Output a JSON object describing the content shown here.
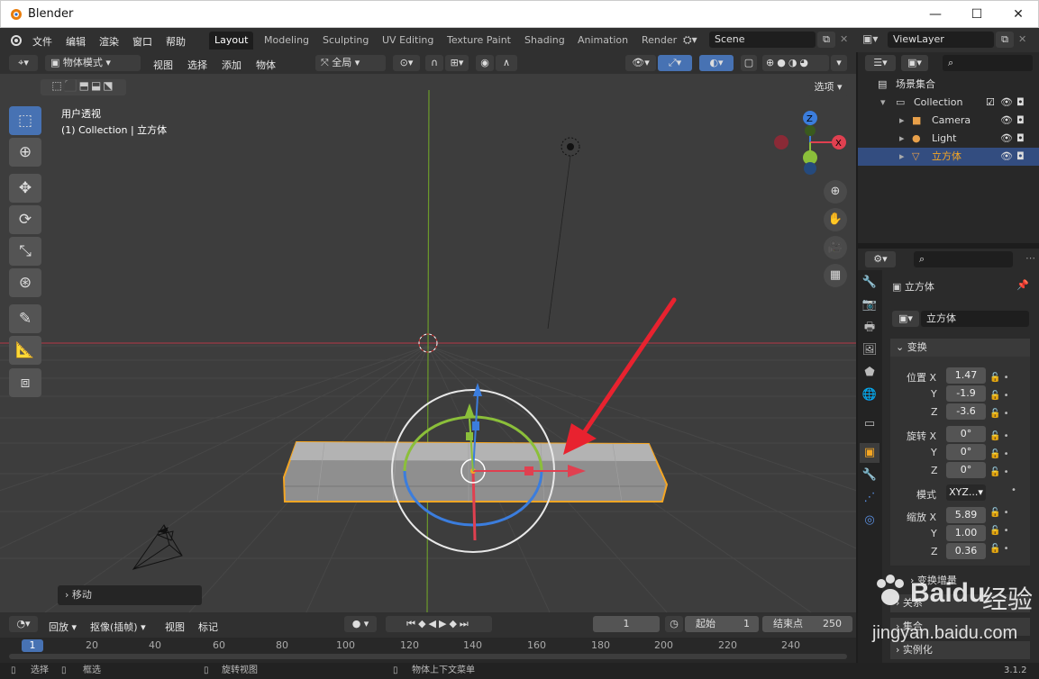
{
  "window": {
    "title": "Blender",
    "minimize": "—",
    "maximize": "☐",
    "close": "✕"
  },
  "menu": [
    "文件",
    "编辑",
    "渲染",
    "窗口",
    "帮助"
  ],
  "workspaces": [
    "Layout",
    "Modeling",
    "Sculpting",
    "UV Editing",
    "Texture Paint",
    "Shading",
    "Animation",
    "Render"
  ],
  "scene": {
    "name": "Scene",
    "view_layer": "ViewLayer"
  },
  "viewport_header": {
    "mode": "物体模式",
    "items": [
      "视图",
      "选择",
      "添加",
      "物体"
    ],
    "transform_orientation": "全局",
    "options": "选项"
  },
  "viewport": {
    "perspective_label": "用户透视",
    "collection_label": "(1) Collection | 立方体",
    "last_op": "移动"
  },
  "outliner": {
    "root": "场景集合",
    "items": [
      {
        "label": "Collection",
        "icon": "collection-icon"
      },
      {
        "label": "Camera",
        "icon": "camera-icon"
      },
      {
        "label": "Light",
        "icon": "light-icon"
      },
      {
        "label": "立方体",
        "icon": "mesh-icon",
        "selected": true
      }
    ]
  },
  "properties": {
    "object_name": "立方体",
    "data_name": "立方体",
    "transform_header": "变换",
    "location": {
      "label": "位置",
      "x": "1.47",
      "y": "-1.9",
      "z": "-3.6"
    },
    "rotation": {
      "label": "旋转",
      "x": "0°",
      "y": "0°",
      "z": "0°"
    },
    "mode_label": "模式",
    "mode_value": "XYZ...",
    "scale": {
      "label": "缩放",
      "x": "5.89",
      "y": "1.00",
      "z": "0.36"
    },
    "axis_x": "X",
    "axis_y": "Y",
    "axis_z": "Z",
    "delta_transform": "变换增量",
    "relations": "关系",
    "collections": "集合",
    "instancing": "实例化"
  },
  "timeline": {
    "playback": "回放",
    "keying": "抠像(插帧)",
    "view": "视图",
    "marker": "标记",
    "current_frame": "1",
    "start_label": "起始",
    "start_value": "1",
    "end_label": "结束点",
    "end_value": "250",
    "ticks": [
      "1",
      "20",
      "40",
      "60",
      "80",
      "100",
      "120",
      "140",
      "160",
      "180",
      "200",
      "220",
      "240"
    ]
  },
  "statusbar": {
    "select": "选择",
    "box_select": "框选",
    "rotate_view": "旋转视图",
    "context_menu": "物体上下文菜单",
    "version": "3.1.2"
  },
  "watermark": {
    "brand": "Baidu",
    "cn": "经验",
    "url": "jingyan.baidu.com"
  },
  "colors": {
    "accent": "#4772b3",
    "selection": "#f5a623",
    "arrow": "#e8222f",
    "x_axis": "#e04050",
    "y_axis": "#8bbf3a",
    "z_axis": "#3b7ddd"
  }
}
